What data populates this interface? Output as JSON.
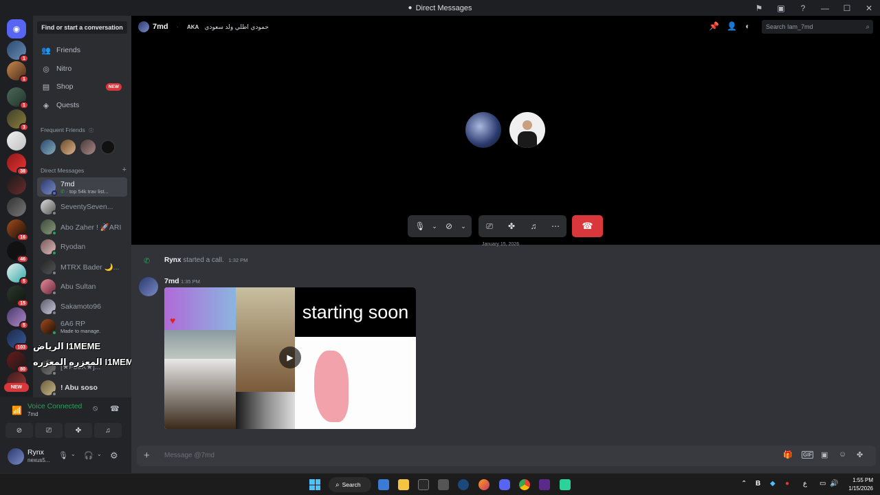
{
  "window": {
    "title": "Direct Messages"
  },
  "sidebar": {
    "find_label": "Find or start a conversation",
    "nav": [
      {
        "label": "Friends",
        "icon": "friends-icon"
      },
      {
        "label": "Nitro",
        "icon": "nitro-icon"
      },
      {
        "label": "Shop",
        "icon": "shop-icon",
        "badge": "NEW"
      },
      {
        "label": "Quests",
        "icon": "quests-icon"
      }
    ],
    "frequent_friends_label": "Frequent Friends",
    "direct_messages_label": "Direct Messages",
    "dms": [
      {
        "name": "7md",
        "sub": "top 54k trav list...",
        "active": true
      },
      {
        "name": "SeventySeven..."
      },
      {
        "name": "Abo Zaher ! 🚀ARI"
      },
      {
        "name": "Ryodan"
      },
      {
        "name": "MTRX Bader 🌙..."
      },
      {
        "name": "Abu Sultan"
      },
      {
        "name": "Sakamoto96"
      },
      {
        "name": "6A6 RP",
        "sub": "Made to manage."
      },
      {
        "name": "[★F50X★]..."
      },
      {
        "name": "! Abu soso"
      }
    ],
    "overlay_text": [
      "الرياض I1MEME",
      "المعزره المعزره I1MEME"
    ]
  },
  "rail": {
    "badges": [
      "1",
      "1",
      "1",
      "3",
      "38",
      "16",
      "46",
      "5",
      "15",
      "5",
      "103",
      "80"
    ],
    "new_label": "NEW"
  },
  "voice": {
    "status": "Voice Connected",
    "channel": "7md"
  },
  "user": {
    "name": "Rynx",
    "tag": "nexus5..."
  },
  "header": {
    "name": "7md",
    "aka_label": "AKA",
    "aka_value": "حمودي اطلي ولد سعودي",
    "search_placeholder": "Search Iam_7md"
  },
  "chat": {
    "date_divider": "January 15, 2026",
    "call_user": "Rynx",
    "call_text": "started a call.",
    "call_time": "1:32 PM",
    "msg_author": "7md",
    "msg_time": "1:35 PM",
    "video_text": "starting soon",
    "input_placeholder": "Message @7md"
  },
  "taskbar": {
    "search_label": "Search",
    "time": "1:55 PM",
    "date": "1/15/2026",
    "lang": "ع"
  },
  "colors": {
    "accent": "#5865f2",
    "hangup": "#da373c",
    "online": "#23a55a"
  }
}
